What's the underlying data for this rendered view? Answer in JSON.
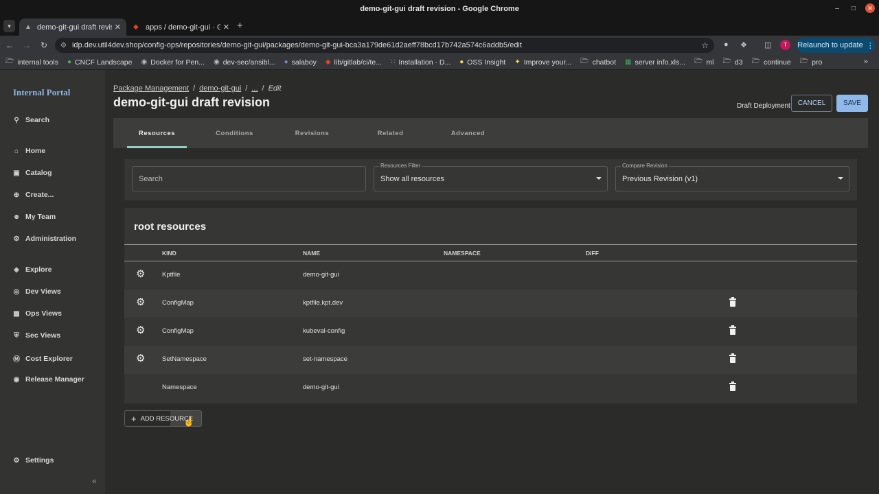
{
  "window": {
    "title": "demo-git-gui draft revision - Google Chrome"
  },
  "browser": {
    "tabs": [
      {
        "label": "demo-git-gui draft revisi",
        "active": true
      },
      {
        "label": "apps / demo-git-gui · Git",
        "active": false
      }
    ],
    "url": "idp.dev.util4dev.shop/config-ops/repositories/demo-git-gui/packages/demo-git-gui-bca3a179de61d2aeff78bcd17b742a574c6addb5/edit",
    "profile_initial": "T",
    "relaunch_label": "Relaunch to update",
    "bookmarks": [
      {
        "label": "internal tools",
        "icon": "folder-icon"
      },
      {
        "label": "CNCF Landscape",
        "icon": "globe-icon"
      },
      {
        "label": "Docker for Pen...",
        "icon": "wordpress-icon"
      },
      {
        "label": "dev-sec/ansibl...",
        "icon": "github-icon"
      },
      {
        "label": "salaboy",
        "icon": "site-icon"
      },
      {
        "label": "lib/gitlab/ci/te...",
        "icon": "gitlab-icon"
      },
      {
        "label": "Installation · D...",
        "icon": "dots-icon"
      },
      {
        "label": "OSS Insight",
        "icon": "site-icon"
      },
      {
        "label": "Improve your...",
        "icon": "site-icon"
      },
      {
        "label": "chatbot",
        "icon": "folder-icon"
      },
      {
        "label": "server info.xls...",
        "icon": "sheet-icon"
      },
      {
        "label": "ml",
        "icon": "folder-icon"
      },
      {
        "label": "d3",
        "icon": "folder-icon"
      },
      {
        "label": "continue",
        "icon": "folder-icon"
      },
      {
        "label": "pro",
        "icon": "folder-icon"
      }
    ]
  },
  "sidebar": {
    "brand": "Internal Portal",
    "search": "Search",
    "items": [
      {
        "label": "Home",
        "icon": "home-icon"
      },
      {
        "label": "Catalog",
        "icon": "catalog-icon"
      },
      {
        "label": "Create...",
        "icon": "create-icon"
      },
      {
        "label": "My Team",
        "icon": "team-icon"
      },
      {
        "label": "Administration",
        "icon": "admin-icon"
      },
      {
        "label": "Explore",
        "icon": "explore-icon"
      },
      {
        "label": "Dev Views",
        "icon": "devviews-icon"
      },
      {
        "label": "Ops Views",
        "icon": "opsviews-icon"
      },
      {
        "label": "Sec Views",
        "icon": "secviews-icon"
      },
      {
        "label": "Cost Explorer",
        "icon": "cost-icon"
      },
      {
        "label": "Release Manager",
        "icon": "release-icon"
      }
    ],
    "settings": "Settings"
  },
  "header": {
    "breadcrumbs": [
      "Package Management",
      "demo-git-gui",
      "...",
      "Edit"
    ],
    "title": "demo-git-gui draft revision",
    "deployment_label": "Draft Deployment",
    "cancel_label": "CANCEL",
    "save_label": "SAVE"
  },
  "tabs": [
    "Resources",
    "Conditions",
    "Revisions",
    "Related",
    "Advanced"
  ],
  "filters": {
    "search_placeholder": "Search",
    "resources_filter_label": "Resources Filter",
    "resources_filter_value": "Show all resources",
    "compare_label": "Compare Revision",
    "compare_value": "Previous Revision (v1)"
  },
  "resources": {
    "title": "root resources",
    "columns": [
      "KIND",
      "NAME",
      "NAMESPACE",
      "DIFF"
    ],
    "rows": [
      {
        "kind": "Kptfile",
        "name": "demo-git-gui",
        "namespace": "",
        "gear": true,
        "delete": false
      },
      {
        "kind": "ConfigMap",
        "name": "kptfile.kpt.dev",
        "namespace": "",
        "gear": true,
        "delete": true
      },
      {
        "kind": "ConfigMap",
        "name": "kubeval-config",
        "namespace": "",
        "gear": true,
        "delete": true
      },
      {
        "kind": "SetNamespace",
        "name": "set-namespace",
        "namespace": "",
        "gear": true,
        "delete": true
      },
      {
        "kind": "Namespace",
        "name": "demo-git-gui",
        "namespace": "",
        "gear": false,
        "delete": true
      }
    ],
    "add_label": "ADD RESOURCE"
  }
}
